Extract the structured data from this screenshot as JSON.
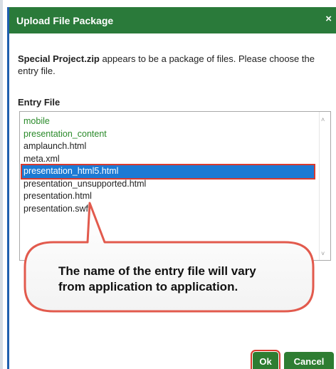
{
  "dialog": {
    "title": "Upload File Package",
    "close_glyph": "×",
    "close_icon": "close-icon"
  },
  "message": {
    "filename": "Special Project.zip",
    "text": " appears to be a package of files. Please choose the entry file."
  },
  "entry_label": "Entry File",
  "list": {
    "items": [
      {
        "label": "mobile",
        "kind": "folder"
      },
      {
        "label": "presentation_content",
        "kind": "folder"
      },
      {
        "label": "amplaunch.html",
        "kind": "file"
      },
      {
        "label": "meta.xml",
        "kind": "file"
      },
      {
        "label": "presentation_html5.html",
        "kind": "file",
        "selected": true
      },
      {
        "label": "presentation_unsupported.html",
        "kind": "file"
      },
      {
        "label": "presentation.html",
        "kind": "file"
      },
      {
        "label": "presentation.swf",
        "kind": "file"
      }
    ],
    "scroll_up_glyph": "˄",
    "scroll_down_glyph": "˅"
  },
  "callout": {
    "line1": "The name of the entry file will vary",
    "line2": "from application to application."
  },
  "buttons": {
    "ok_label": "Ok",
    "cancel_label": "Cancel"
  },
  "colors": {
    "titlebar": "#2a7a3a",
    "folder_text": "#2a8a2a",
    "selection": "#1c7ad4",
    "highlight": "#d83a2e",
    "button": "#2e7d32"
  }
}
